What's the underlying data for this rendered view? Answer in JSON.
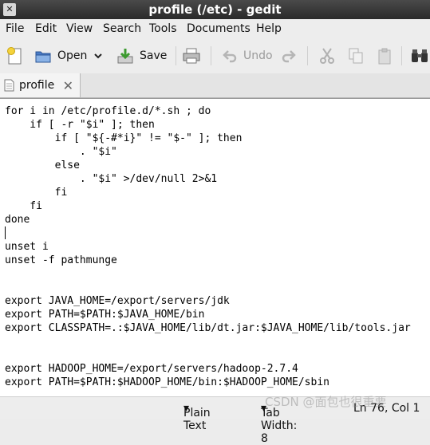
{
  "window": {
    "title": "profile (/etc) - gedit"
  },
  "menu": {
    "items": [
      "File",
      "Edit",
      "View",
      "Search",
      "Tools",
      "Documents",
      "Help"
    ]
  },
  "toolbar": {
    "open_label": "Open",
    "save_label": "Save",
    "undo_label": "Undo"
  },
  "tab": {
    "label": "profile"
  },
  "editor": {
    "lines": [
      "for i in /etc/profile.d/*.sh ; do",
      "    if [ -r \"$i\" ]; then",
      "        if [ \"${-#*i}\" != \"$-\" ]; then",
      "            . \"$i\"",
      "        else",
      "            . \"$i\" >/dev/null 2>&1",
      "        fi",
      "    fi",
      "done",
      "",
      "unset i",
      "unset -f pathmunge",
      "",
      "",
      "export JAVA_HOME=/export/servers/jdk",
      "export PATH=$PATH:$JAVA_HOME/bin",
      "export CLASSPATH=.:$JAVA_HOME/lib/dt.jar:$JAVA_HOME/lib/tools.jar",
      "",
      "",
      "export HADOOP_HOME=/export/servers/hadoop-2.7.4",
      "export PATH=$PATH:$HADOOP_HOME/bin:$HADOOP_HOME/sbin"
    ]
  },
  "status": {
    "language": "Plain Text",
    "tab_width": "Tab Width: 8",
    "position": "Ln 76, Col 1"
  },
  "watermark": "CSDN @面包也很重要"
}
